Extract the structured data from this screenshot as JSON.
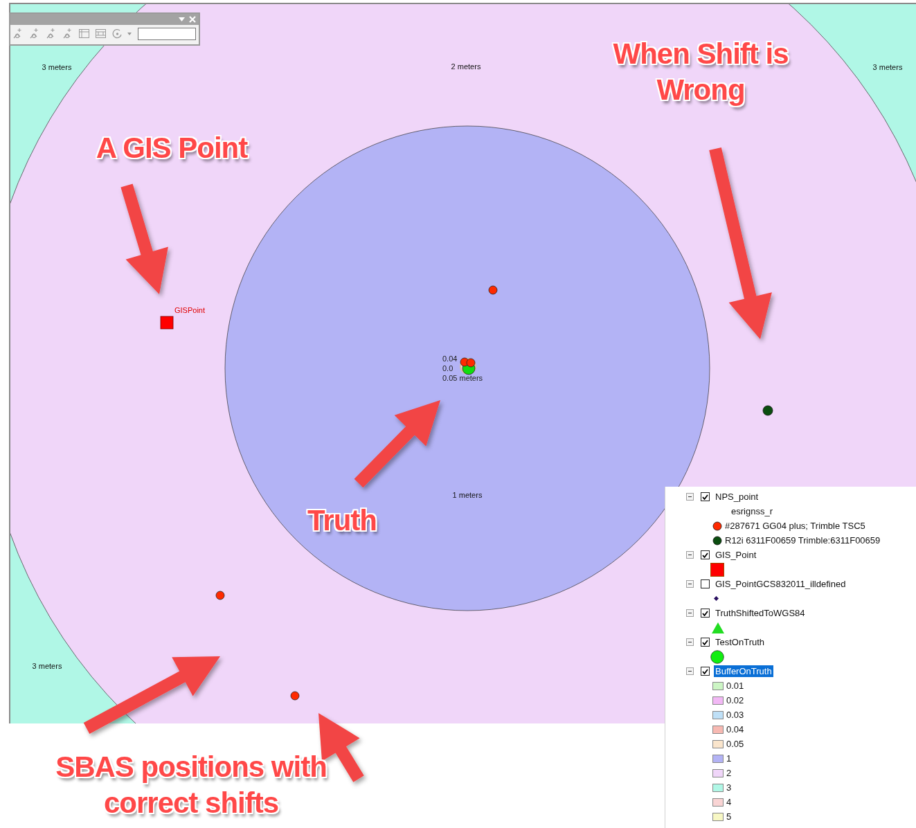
{
  "map": {
    "ring_labels": [
      "3 meters",
      "2 meters",
      "3 meters",
      "1 meters",
      "3 meters"
    ],
    "center_labels": [
      "0.04",
      "0.0",
      "0.05 meters"
    ],
    "point_label": "GISPoint"
  },
  "annotations": [
    "When Shift is\nWrong",
    "A GIS Point",
    "Truth",
    "SBAS positions with\ncorrect shifts"
  ],
  "legend": {
    "layers": [
      {
        "name": "NPS_point",
        "checked": true,
        "expanded": true,
        "selected": false,
        "symbols": [
          {
            "kind": "heading",
            "label": "esrignss_r"
          },
          {
            "kind": "dot",
            "color": "#ff2a00",
            "label": "#287671 GG04 plus; Trimble TSC5"
          },
          {
            "kind": "dot",
            "color": "#0b4d10",
            "label": "R12i  6311F00659  Trimble:6311F00659"
          }
        ]
      },
      {
        "name": "GIS_Point",
        "checked": true,
        "expanded": true,
        "selected": false,
        "symbols": [
          {
            "kind": "square",
            "color": "#ff0000"
          }
        ]
      },
      {
        "name": "GIS_PointGCS832011_illdefined",
        "checked": false,
        "expanded": true,
        "selected": false,
        "symbols": [
          {
            "kind": "diamond",
            "color": "#2a1060"
          }
        ]
      },
      {
        "name": "TruthShiftedToWGS84",
        "checked": true,
        "expanded": true,
        "selected": false,
        "symbols": [
          {
            "kind": "triangle",
            "color": "#22dd22"
          }
        ]
      },
      {
        "name": "TestOnTruth",
        "checked": true,
        "expanded": true,
        "selected": false,
        "symbols": [
          {
            "kind": "circle",
            "color": "#11ee11"
          }
        ]
      },
      {
        "name": "BufferOnTruth",
        "checked": true,
        "expanded": true,
        "selected": true,
        "symbols": [
          {
            "kind": "patch",
            "color": "#ccf5c4",
            "label": "0.01"
          },
          {
            "kind": "patch",
            "color": "#f2b8f5",
            "label": "0.02"
          },
          {
            "kind": "patch",
            "color": "#bfe0f7",
            "label": "0.03"
          },
          {
            "kind": "patch",
            "color": "#f7b9b2",
            "label": "0.04"
          },
          {
            "kind": "patch",
            "color": "#fae5cc",
            "label": "0.05"
          },
          {
            "kind": "patch",
            "color": "#b3b3f5",
            "label": "1"
          },
          {
            "kind": "patch",
            "color": "#f0d6f9",
            "label": "2"
          },
          {
            "kind": "patch",
            "color": "#b0f7e6",
            "label": "3"
          },
          {
            "kind": "patch",
            "color": "#f9d4d4",
            "label": "4"
          },
          {
            "kind": "patch",
            "color": "#f7f7c4",
            "label": "5"
          }
        ]
      }
    ]
  }
}
